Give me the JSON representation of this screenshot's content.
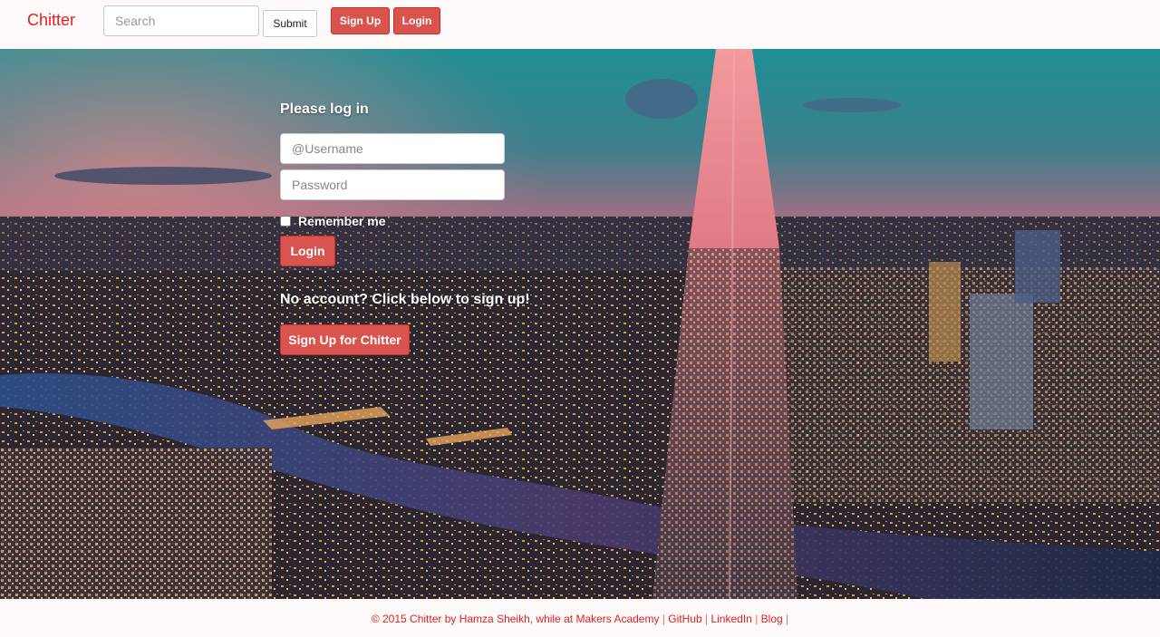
{
  "navbar": {
    "brand": "Chitter",
    "search_placeholder": "Search",
    "submit_label": "Submit",
    "signup_label": "Sign Up",
    "login_label": "Login"
  },
  "login": {
    "title": "Please log in",
    "username_placeholder": "@Username",
    "password_placeholder": "Password",
    "remember_label": "Remember me",
    "login_button": "Login",
    "no_account_text": "No account? Click below to sign up!",
    "signup_button": "Sign Up for Chitter"
  },
  "footer": {
    "credit": "© 2015 Chitter by Hamza Sheikh, while at Makers Academy",
    "links": [
      "GitHub",
      "LinkedIn",
      "Blog"
    ],
    "separator": "|"
  },
  "colors": {
    "brand": "#e02020",
    "button": "#d9534f",
    "bar_background": "#fdf9f8"
  }
}
